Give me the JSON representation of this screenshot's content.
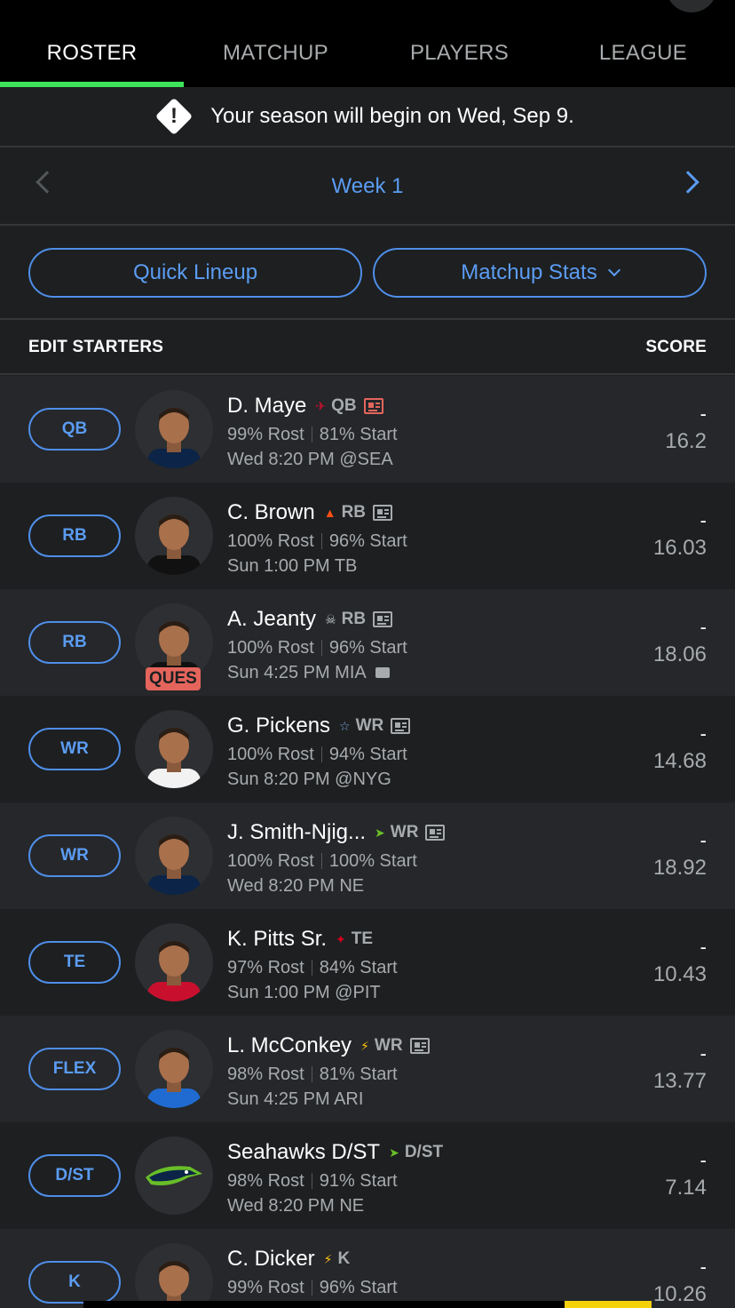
{
  "tabs": [
    {
      "label": "ROSTER",
      "active": true
    },
    {
      "label": "MATCHUP",
      "active": false
    },
    {
      "label": "PLAYERS",
      "active": false
    },
    {
      "label": "LEAGUE",
      "active": false
    }
  ],
  "notice": {
    "icon": "alert-icon",
    "text": "Your season will begin on Wed, Sep 9."
  },
  "week": {
    "label": "Week 1"
  },
  "actions": {
    "quick_lineup": "Quick Lineup",
    "matchup_stats": "Matchup Stats"
  },
  "section": {
    "left": "EDIT STARTERS",
    "right": "SCORE"
  },
  "colors": {
    "accent": "#5b9cf2",
    "active_tab": "#3ee35b",
    "injury": "#e5655c"
  },
  "players": [
    {
      "slot": "QB",
      "name": "D. Maye",
      "team_logo": "patriots",
      "pos": "QB",
      "news": "red",
      "rost": "99% Rost",
      "start": "81% Start",
      "game": "Wed 8:20 PM @SEA",
      "tv": false,
      "status": "",
      "score": "-",
      "proj": "16.2"
    },
    {
      "slot": "RB",
      "name": "C. Brown",
      "team_logo": "bengals",
      "pos": "RB",
      "news": "grey",
      "rost": "100% Rost",
      "start": "96% Start",
      "game": "Sun 1:00 PM TB",
      "tv": false,
      "status": "",
      "score": "-",
      "proj": "16.03"
    },
    {
      "slot": "RB",
      "name": "A. Jeanty",
      "team_logo": "raiders",
      "pos": "RB",
      "news": "grey",
      "rost": "100% Rost",
      "start": "96% Start",
      "game": "Sun 4:25 PM MIA",
      "tv": true,
      "status": "QUES",
      "score": "-",
      "proj": "18.06"
    },
    {
      "slot": "WR",
      "name": "G. Pickens",
      "team_logo": "cowboys",
      "pos": "WR",
      "news": "grey",
      "rost": "100% Rost",
      "start": "94% Start",
      "game": "Sun 8:20 PM @NYG",
      "tv": false,
      "status": "",
      "score": "-",
      "proj": "14.68"
    },
    {
      "slot": "WR",
      "name": "J. Smith-Njig...",
      "team_logo": "seahawks",
      "pos": "WR",
      "news": "grey",
      "rost": "100% Rost",
      "start": "100% Start",
      "game": "Wed 8:20 PM NE",
      "tv": false,
      "status": "",
      "score": "-",
      "proj": "18.92"
    },
    {
      "slot": "TE",
      "name": "K. Pitts Sr.",
      "team_logo": "falcons",
      "pos": "TE",
      "news": "none",
      "rost": "97% Rost",
      "start": "84% Start",
      "game": "Sun 1:00 PM @PIT",
      "tv": false,
      "status": "",
      "score": "-",
      "proj": "10.43"
    },
    {
      "slot": "FLEX",
      "name": "L. McConkey",
      "team_logo": "chargers",
      "pos": "WR",
      "news": "grey",
      "rost": "98% Rost",
      "start": "81% Start",
      "game": "Sun 4:25 PM ARI",
      "tv": false,
      "status": "",
      "score": "-",
      "proj": "13.77"
    },
    {
      "slot": "D/ST",
      "name": "Seahawks D/ST",
      "team_logo": "seahawks",
      "pos": "D/ST",
      "news": "none",
      "rost": "98% Rost",
      "start": "91% Start",
      "game": "Wed 8:20 PM NE",
      "tv": false,
      "status": "",
      "score": "-",
      "proj": "7.14"
    },
    {
      "slot": "K",
      "name": "C. Dicker",
      "team_logo": "chargers",
      "pos": "K",
      "news": "none",
      "rost": "99% Rost",
      "start": "96% Start",
      "game": "",
      "tv": false,
      "status": "",
      "score": "-",
      "proj": "10.26"
    }
  ]
}
